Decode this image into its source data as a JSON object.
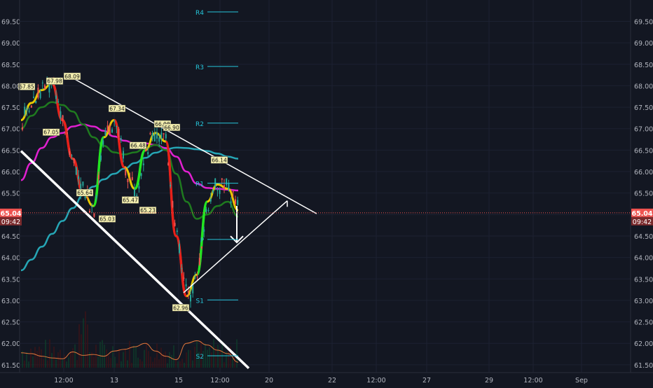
{
  "chart_data": {
    "type": "candlestick",
    "title": "",
    "ylim": [
      61.4,
      69.72
    ],
    "price_ticks": [
      "69.50",
      "69.00",
      "68.50",
      "68.00",
      "67.50",
      "67.00",
      "66.50",
      "66.00",
      "65.50",
      "65.00",
      "64.50",
      "64.00",
      "63.50",
      "63.00",
      "62.50",
      "62.00",
      "61.50"
    ],
    "time_ticks": [
      "12:00",
      "13",
      "15",
      "12:00",
      "20",
      "22",
      "12:00",
      "27",
      "29",
      "12:00",
      "Sep"
    ],
    "current_price": {
      "price": "65.04",
      "countdown": "09:42",
      "color": "#ef5350"
    },
    "pivot_levels": [
      {
        "name": "R4",
        "value": 69.72
      },
      {
        "name": "R3",
        "value": 68.45
      },
      {
        "name": "R2",
        "value": 67.13
      },
      {
        "name": "R1",
        "value": 65.73
      },
      {
        "name": "P",
        "value": 64.42
      },
      {
        "name": "S1",
        "value": 63.01
      },
      {
        "name": "S2",
        "value": 61.71
      }
    ],
    "swing_labels": [
      {
        "text": "67.85",
        "price": 67.85,
        "pos": "above"
      },
      {
        "text": "67.98",
        "price": 67.98,
        "pos": "above"
      },
      {
        "text": "68.09",
        "price": 68.09,
        "pos": "above"
      },
      {
        "text": "67.05",
        "price": 67.05,
        "pos": "below"
      },
      {
        "text": "67.34",
        "price": 67.34,
        "pos": "above"
      },
      {
        "text": "65.64",
        "price": 65.64,
        "pos": "below"
      },
      {
        "text": "65.03",
        "price": 65.03,
        "pos": "below"
      },
      {
        "text": "66.48",
        "price": 66.48,
        "pos": "above"
      },
      {
        "text": "65.47",
        "price": 65.47,
        "pos": "below"
      },
      {
        "text": "65.23",
        "price": 65.23,
        "pos": "below"
      },
      {
        "text": "66.98",
        "price": 66.98,
        "pos": "above"
      },
      {
        "text": "66.90",
        "price": 66.9,
        "pos": "above"
      },
      {
        "text": "66.14",
        "price": 66.14,
        "pos": "above"
      },
      {
        "text": "62.96",
        "price": 62.96,
        "pos": "below"
      }
    ],
    "series": [
      {
        "indicator": "ema-long",
        "color": "#26a6b5",
        "values": [
          63.7,
          63.95,
          64.25,
          64.55,
          64.85,
          65.15,
          65.45,
          65.65,
          65.82,
          65.95,
          66.07,
          66.2,
          66.32,
          66.44,
          66.52,
          66.56,
          66.55,
          66.52,
          66.48,
          66.42,
          66.35,
          66.3
        ]
      },
      {
        "indicator": "ema-mid",
        "color": "#e020d0",
        "values": [
          65.8,
          66.2,
          66.55,
          66.8,
          66.9,
          67.05,
          67.1,
          67.05,
          66.95,
          66.82,
          66.72,
          66.66,
          66.66,
          66.62,
          66.55,
          66.35,
          66.0,
          65.72,
          65.62,
          65.6,
          65.58,
          65.56
        ]
      },
      {
        "indicator": "ema-short",
        "color": "#1f7a1f",
        "values": [
          67.0,
          67.3,
          67.5,
          67.62,
          67.55,
          67.4,
          67.1,
          66.8,
          66.6,
          66.45,
          66.4,
          66.45,
          66.55,
          66.62,
          66.5,
          65.95,
          65.3,
          64.9,
          65.0,
          65.2,
          65.3,
          64.95
        ]
      },
      {
        "indicator": "hull-ma",
        "color": "#e8c800",
        "values": [
          67.2,
          67.6,
          67.9,
          68.05,
          67.2,
          66.3,
          65.5,
          65.2,
          66.8,
          67.2,
          66.1,
          65.6,
          66.5,
          66.9,
          66.7,
          64.5,
          63.1,
          63.6,
          65.3,
          65.7,
          65.6,
          65.1
        ]
      },
      {
        "indicator": "volume-osc",
        "color": "#e0753a",
        "values": [
          61.78,
          61.76,
          61.7,
          61.66,
          61.64,
          61.8,
          61.72,
          61.74,
          61.7,
          61.82,
          61.86,
          61.92,
          62.0,
          61.82,
          61.7,
          61.62,
          62.0,
          62.06,
          61.96,
          61.84,
          61.76,
          61.56
        ]
      }
    ],
    "trendlines": [
      {
        "name": "descending-resistance",
        "from": [
          "12:00",
          68.15
        ],
        "to": [
          "20+",
          65.02
        ]
      },
      {
        "name": "descending-support",
        "from": [
          "start",
          66.48
        ],
        "to": [
          "20",
          61.42
        ]
      },
      {
        "name": "ascending-support",
        "from": [
          "15",
          63.18
        ],
        "to": [
          "20",
          65.32
        ]
      }
    ],
    "annotation": {
      "type": "arrow-down",
      "from_price": 65.2,
      "to_price": 64.35
    }
  }
}
